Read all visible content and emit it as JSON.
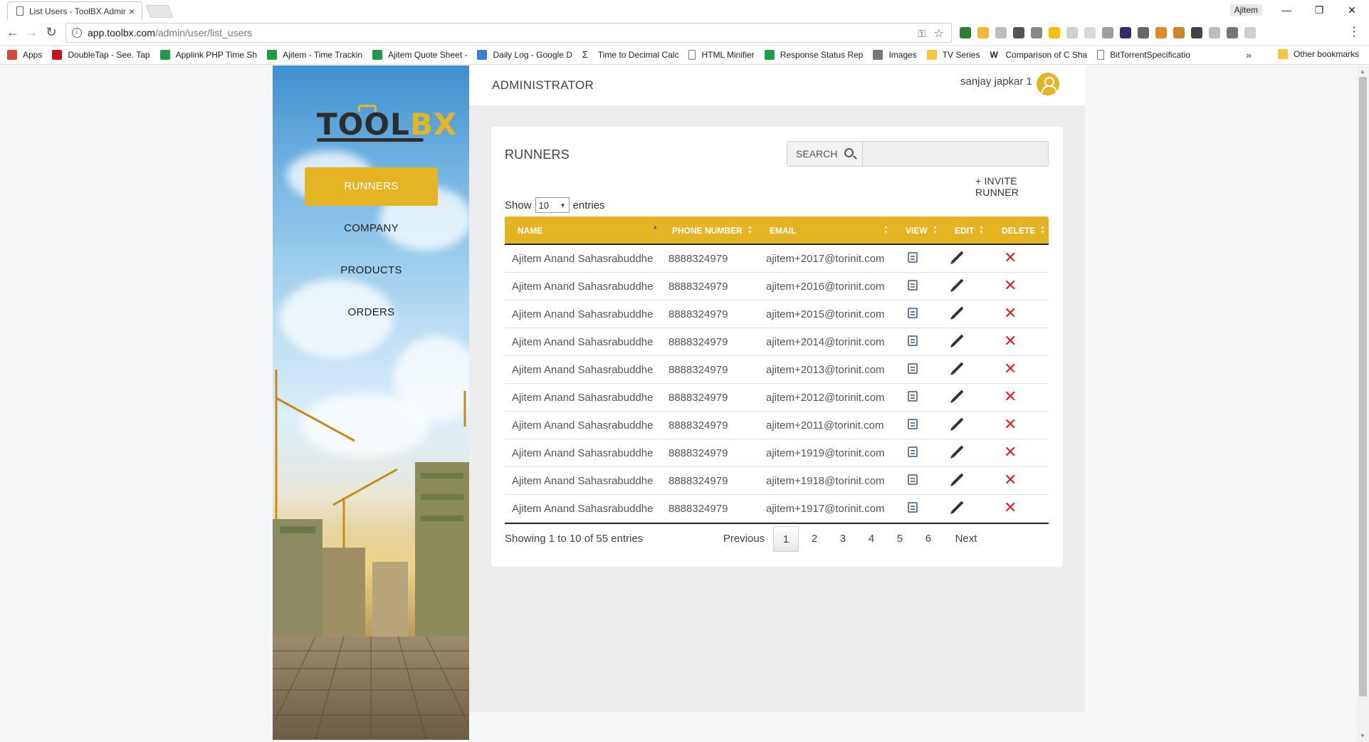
{
  "browser": {
    "tab_title": "List Users - ToolBX Admin",
    "tab_close": "×",
    "window_user": "Ajitem",
    "url_host": "app.toolbx.com",
    "url_path": "/admin/user/list_users",
    "bookmarks": [
      {
        "label": "Apps",
        "color": "#d44a3a"
      },
      {
        "label": "DoubleTap - See. Tap",
        "color": "#c0181e"
      },
      {
        "label": "Applink PHP Time Sh",
        "color": "#1e9b4b"
      },
      {
        "label": "Ajitem - Time Trackin",
        "color": "#1e9b4b"
      },
      {
        "label": "Ajitem Quote Sheet -",
        "color": "#1e9b4b"
      },
      {
        "label": "Daily Log - Google D",
        "color": "#3a7bd5"
      },
      {
        "label": "Time to Decimal Calc",
        "color": "#333333"
      },
      {
        "label": "HTML Minifier",
        "color": "#bbbbbb"
      },
      {
        "label": "Response Status Rep",
        "color": "#1e9b4b"
      },
      {
        "label": "Images",
        "color": "#777777"
      },
      {
        "label": "TV Series",
        "color": "#f4c542"
      },
      {
        "label": "Comparison of C Sha",
        "color": "#333333"
      },
      {
        "label": "BitTorrentSpecificatio",
        "color": "#bbbbbb"
      }
    ],
    "bookmarks_more": "»",
    "other_bookmarks": "Other bookmarks"
  },
  "sidebar": {
    "logo_tool": "TOOL",
    "logo_bx": "BX",
    "nav": [
      {
        "label": "RUNNERS",
        "active": true
      },
      {
        "label": "COMPANY",
        "active": false
      },
      {
        "label": "PRODUCTS",
        "active": false
      },
      {
        "label": "ORDERS",
        "active": false
      }
    ]
  },
  "header": {
    "title": "ADMINISTRATOR",
    "user_name": "sanjay japkar 1"
  },
  "runners": {
    "title": "RUNNERS",
    "search_label": "SEARCH",
    "search_value": "",
    "invite_label": "+ INVITE RUNNER",
    "show_label": "Show",
    "page_size": "10",
    "entries_label": "entries",
    "columns": [
      "NAME",
      "PHONE NUMBER",
      "EMAIL",
      "VIEW",
      "EDIT",
      "DELETE"
    ],
    "rows": [
      {
        "name": "Ajitem Anand Sahasrabuddhe",
        "phone": "8888324979",
        "email": "ajitem+2017@torinit.com"
      },
      {
        "name": "Ajitem Anand Sahasrabuddhe",
        "phone": "8888324979",
        "email": "ajitem+2016@torinit.com"
      },
      {
        "name": "Ajitem Anand Sahasrabuddhe",
        "phone": "8888324979",
        "email": "ajitem+2015@torinit.com"
      },
      {
        "name": "Ajitem Anand Sahasrabuddhe",
        "phone": "8888324979",
        "email": "ajitem+2014@torinit.com"
      },
      {
        "name": "Ajitem Anand Sahasrabuddhe",
        "phone": "8888324979",
        "email": "ajitem+2013@torinit.com"
      },
      {
        "name": "Ajitem Anand Sahasrabuddhe",
        "phone": "8888324979",
        "email": "ajitem+2012@torinit.com"
      },
      {
        "name": "Ajitem Anand Sahasrabuddhe",
        "phone": "8888324979",
        "email": "ajitem+2011@torinit.com"
      },
      {
        "name": "Ajitem Anand Sahasrabuddhe",
        "phone": "8888324979",
        "email": "ajitem+1919@torinit.com"
      },
      {
        "name": "Ajitem Anand Sahasrabuddhe",
        "phone": "8888324979",
        "email": "ajitem+1918@torinit.com"
      },
      {
        "name": "Ajitem Anand Sahasrabuddhe",
        "phone": "8888324979",
        "email": "ajitem+1917@torinit.com"
      }
    ],
    "info": "Showing 1 to 10 of 55 entries",
    "pager": {
      "previous": "Previous",
      "pages": [
        "1",
        "2",
        "3",
        "4",
        "5",
        "6"
      ],
      "current": "1",
      "next": "Next"
    }
  },
  "colors": {
    "accent": "#e4b424",
    "delete": "#e02020"
  }
}
